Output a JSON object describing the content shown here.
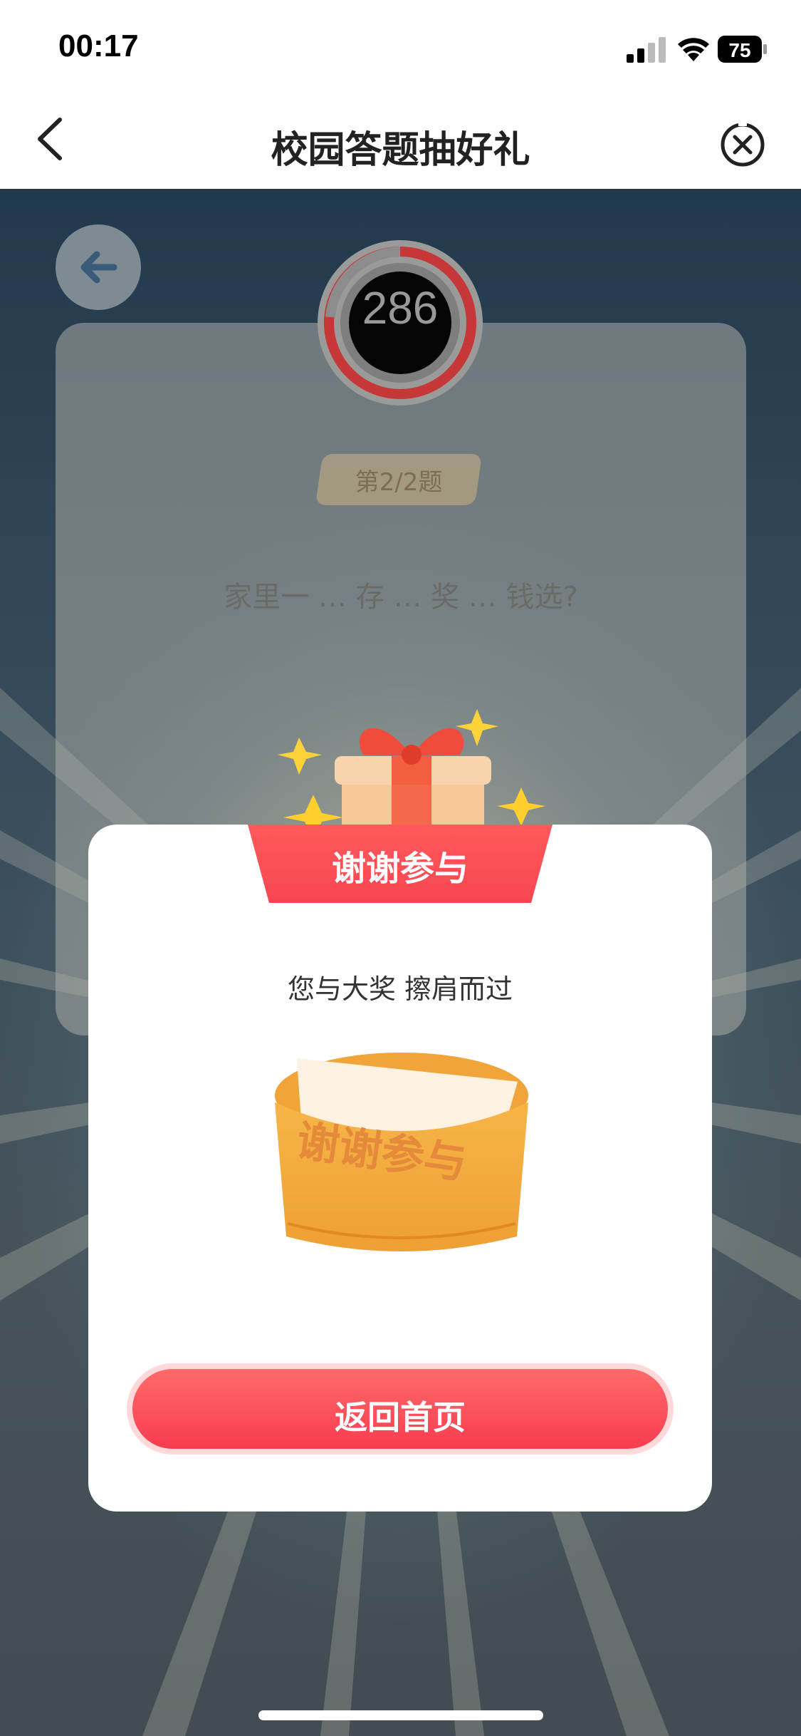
{
  "status_bar": {
    "time": "00:17",
    "battery": "75"
  },
  "nav": {
    "title": "校园答题抽好礼"
  },
  "quiz": {
    "timer": "286",
    "progress_badge": "第2/2题",
    "question_text": "家里一 … 存 … 奖 … 钱选?"
  },
  "modal": {
    "header": "谢谢参与",
    "message": "您与大奖 擦肩而过",
    "envelope_card_text": "谢谢参与",
    "button_label": "返回首页"
  },
  "colors": {
    "accent_red": "#f84a55",
    "envelope_orange": "#f2a63b",
    "text_dark": "#222222"
  },
  "icons": [
    "chevron-left-icon",
    "close-circle-icon",
    "arrow-left-icon",
    "signal-icon",
    "wifi-icon",
    "battery-icon",
    "gift-box-icon",
    "sparkle-icon",
    "envelope-icon"
  ]
}
